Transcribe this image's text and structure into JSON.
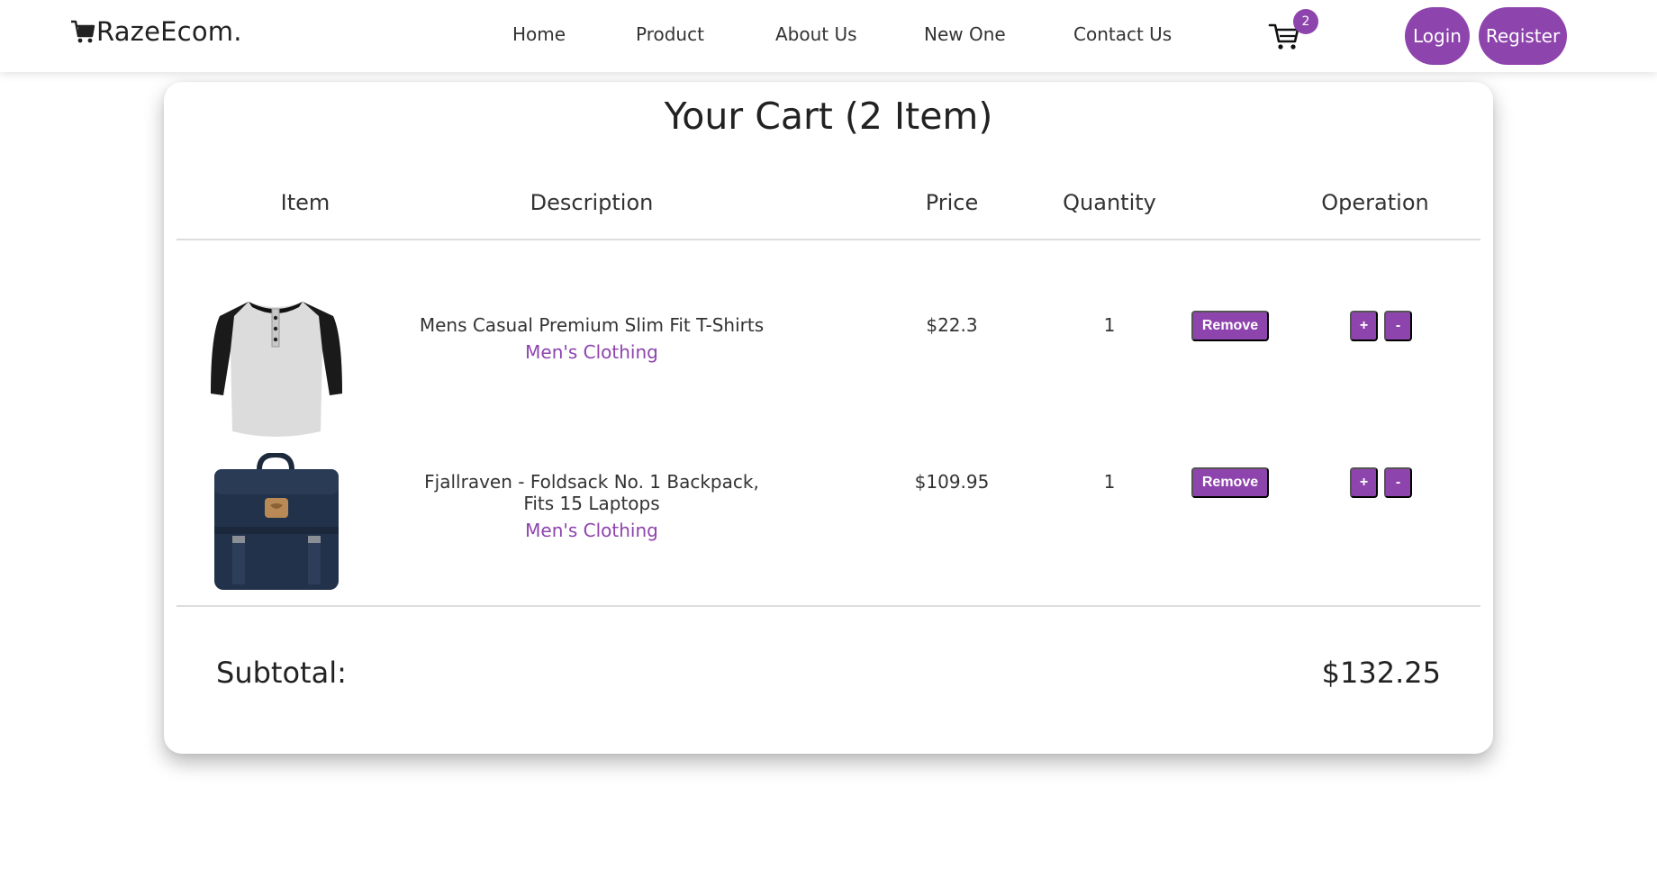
{
  "brand": {
    "name": "RazeEcom.",
    "icon": "cart-icon"
  },
  "nav": {
    "links": [
      "Home",
      "Product",
      "About Us",
      "New One",
      "Contact Us"
    ],
    "cart_count": "2",
    "login_label": "Login",
    "register_label": "Register"
  },
  "cart": {
    "title": "Your Cart (2 Item)",
    "headers": [
      "Item",
      "Description",
      "Price",
      "Quantity",
      "Operation"
    ],
    "items": [
      {
        "title": "Mens Casual Premium Slim Fit T-Shirts",
        "category": "Men's Clothing",
        "price": "$22.3",
        "quantity": "1",
        "remove_label": "Remove",
        "plus_label": "+",
        "minus_label": "-",
        "image": "henley-tshirt-image"
      },
      {
        "title": "Fjallraven - Foldsack No. 1 Backpack, Fits 15 Laptops",
        "category": "Men's Clothing",
        "price": "$109.95",
        "quantity": "1",
        "remove_label": "Remove",
        "plus_label": "+",
        "minus_label": "-",
        "image": "backpack-image"
      }
    ],
    "subtotal_label": "Subtotal:",
    "subtotal_value": "$132.25"
  },
  "colors": {
    "accent": "#8e44ad",
    "text": "#222222"
  }
}
